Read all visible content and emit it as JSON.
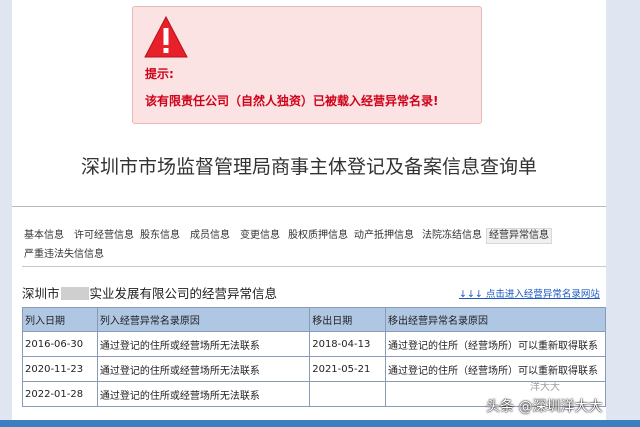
{
  "alert": {
    "icon": "warning-triangle-icon",
    "title": "提示:",
    "message": "该有限责任公司（自然人独资）已被载入经营异常名录!"
  },
  "page_title": "深圳市市场监督管理局商事主体登记及备案信息查询单",
  "tabs": [
    {
      "label": "基本信息",
      "active": false
    },
    {
      "label": "许可经营信息",
      "active": false
    },
    {
      "label": "股东信息",
      "active": false
    },
    {
      "label": "成员信息",
      "active": false
    },
    {
      "label": "变更信息",
      "active": false
    },
    {
      "label": "股权质押信息",
      "active": false
    },
    {
      "label": "动产抵押信息",
      "active": false
    },
    {
      "label": "法院冻结信息",
      "active": false
    },
    {
      "label": "经营异常信息",
      "active": true
    },
    {
      "label": "严重违法失信信息",
      "active": false
    }
  ],
  "company": {
    "prefix": "深圳市",
    "suffix": "实业发展有限公司的经营异常信息"
  },
  "link_text": "↓↓↓ 点击进入经营异常名录网站",
  "table": {
    "headers": [
      "列入日期",
      "列入经营异常名录原因",
      "移出日期",
      "移出经营异常名录原因"
    ],
    "rows": [
      [
        "2016-06-30",
        "通过登记的住所或经营场所无法联系",
        "2018-04-13",
        "通过登记的住所（经营场所）可以重新取得联系"
      ],
      [
        "2020-11-23",
        "通过登记的住所或经营场所无法联系",
        "2021-05-21",
        "通过登记的住所（经营场所）可以重新取得联系"
      ],
      [
        "2022-01-28",
        "通过登记的住所或经营场所无法联系",
        "",
        ""
      ]
    ]
  },
  "watermark": "头条 @深圳洋大大",
  "faint_logo": "洋大大",
  "colors": {
    "alert_text": "#d0021b",
    "alert_bg": "#fbe3e3",
    "table_header_bg": "#b0c7e4",
    "link": "#1a56c4"
  }
}
